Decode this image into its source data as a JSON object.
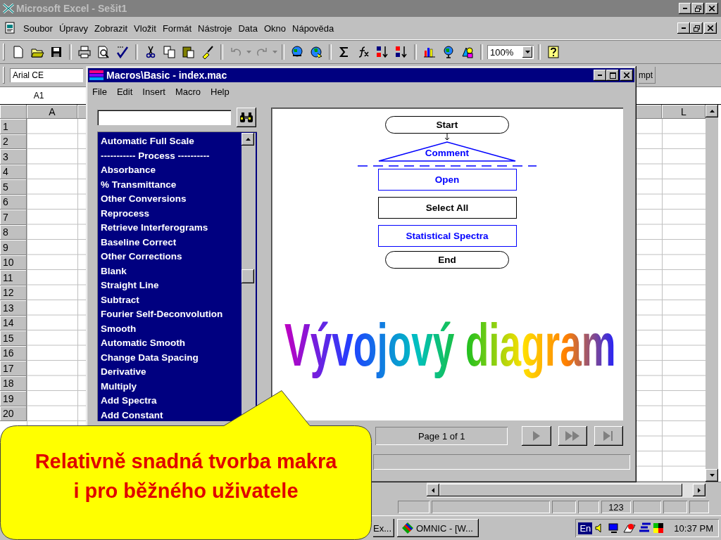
{
  "excel": {
    "title": "Microsoft Excel - Sešit1",
    "menu": [
      "Soubor",
      "Úpravy",
      "Zobrazit",
      "Vložit",
      "Formát",
      "Nástroje",
      "Data",
      "Okno",
      "Nápověda"
    ],
    "zoom": "100%",
    "font": "Arial CE",
    "partial_button": "mpt",
    "name_box": "A1",
    "column_a": "A",
    "column_l": "L",
    "rows": [
      "1",
      "2",
      "3",
      "4",
      "5",
      "6",
      "7",
      "8",
      "9",
      "10",
      "11",
      "12",
      "13",
      "14",
      "15",
      "16",
      "17",
      "18",
      "19",
      "20"
    ],
    "status_num": "123"
  },
  "macro_window": {
    "title": "Macros\\Basic - index.mac",
    "menu": [
      "File",
      "Edit",
      "Insert",
      "Macro",
      "Help"
    ],
    "commands": [
      "Automatic Full Scale",
      "----------- Process ----------",
      "Absorbance",
      "% Transmittance",
      "Other Conversions",
      "Reprocess",
      "Retrieve Interferograms",
      "Baseline Correct",
      "Other Corrections",
      "Blank",
      "Straight Line",
      "Subtract",
      "Fourier Self-Deconvolution",
      "Smooth",
      "Automatic Smooth",
      "Change Data Spacing",
      "Derivative",
      "Multiply",
      "Add Spectra",
      "Add Constant"
    ],
    "flowchart": [
      {
        "kind": "terminal",
        "label": "Start",
        "color": "#000000"
      },
      {
        "kind": "comment",
        "label": "Comment",
        "color": "#0000ff"
      },
      {
        "kind": "step",
        "label": "Open",
        "color": "#0000ff"
      },
      {
        "kind": "step",
        "label": "Select All",
        "color": "#000000"
      },
      {
        "kind": "step",
        "label": "Statistical Spectra",
        "color": "#0000ff"
      },
      {
        "kind": "terminal",
        "label": "End",
        "color": "#000000"
      }
    ],
    "page": "Page 1 of 1"
  },
  "wordart": "Vývojový diagram",
  "callout": "Relativně snadná tvorba makra\ni pro běžného uživatele",
  "taskbar": {
    "buttons": [
      "Ex...",
      "OMNIC - [W..."
    ],
    "language": "En",
    "clock": "10:37 PM"
  }
}
